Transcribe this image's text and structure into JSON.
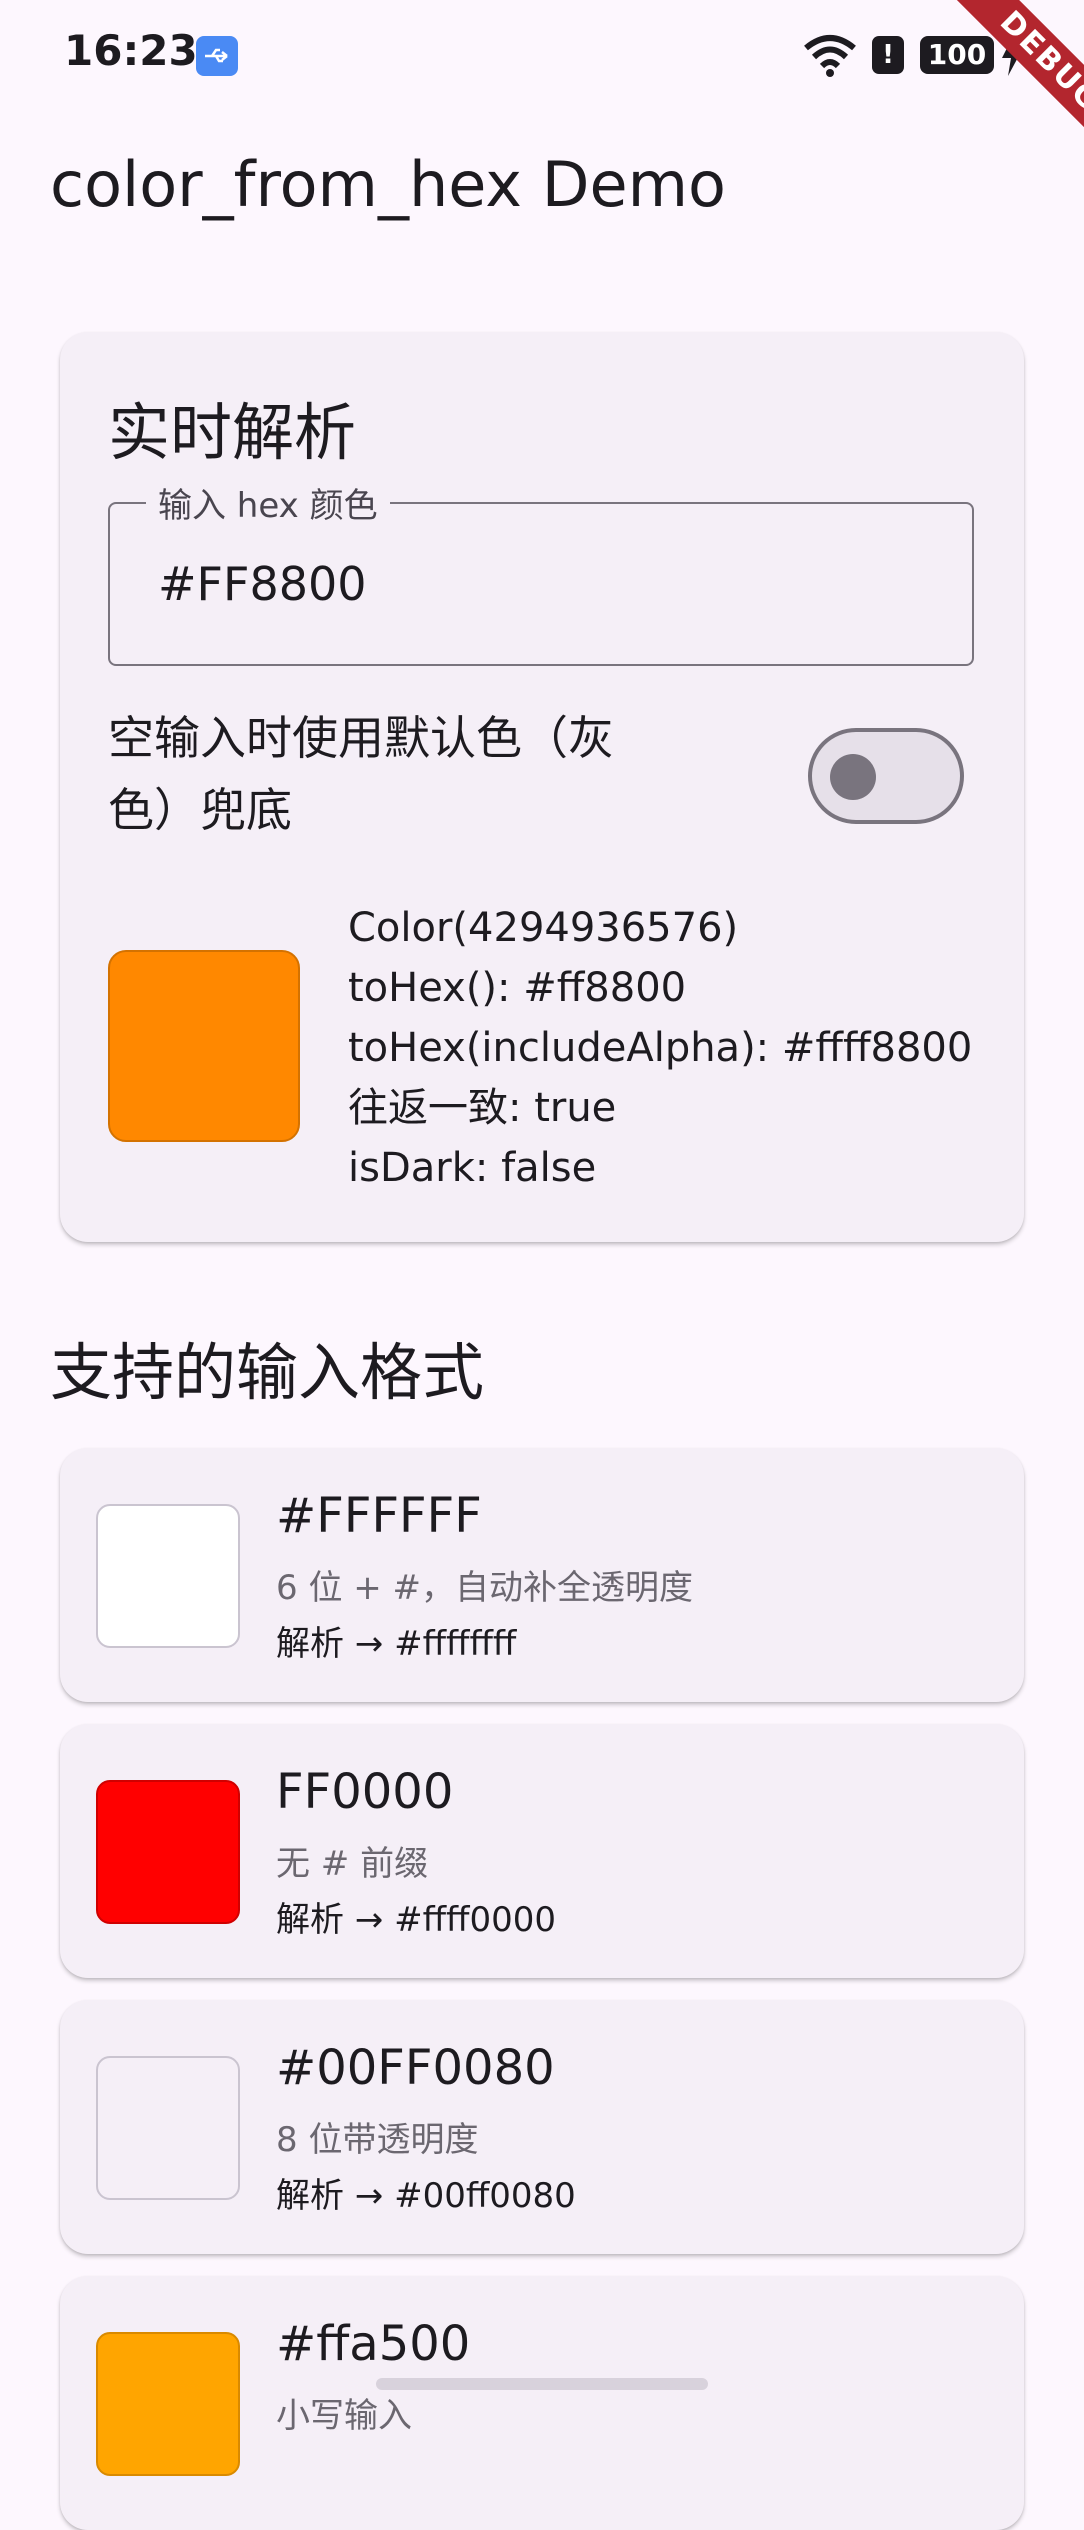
{
  "status_bar": {
    "time": "16:23",
    "battery": "100",
    "icons": [
      "usb-icon",
      "wifi-icon",
      "alert-icon",
      "battery-icon",
      "charging-icon"
    ]
  },
  "debug_banner": "DEBUG",
  "app_bar": {
    "title": "color_from_hex Demo"
  },
  "live_card": {
    "title": "实时解析",
    "input_label": "输入 hex 颜色",
    "input_value": "#FF8800",
    "switch_label": "空输入时使用默认色（灰色）兜底",
    "switch_on": false,
    "swatch_color": "#ff8800",
    "lines": [
      "Color(4294936576)",
      "toHex(): #ff8800",
      "toHex(includeAlpha): #ffff8800",
      "往返一致: true",
      "isDark: false"
    ]
  },
  "formats": {
    "title": "支持的输入格式",
    "items": [
      {
        "input": "#FFFFFF",
        "desc": "6 位 + #，自动补全透明度",
        "parsed": "解析 → #ffffffff",
        "color": "#ffffff"
      },
      {
        "input": "FF0000",
        "desc": "无 # 前缀",
        "parsed": "解析 → #ffff0000",
        "color": "#ff0000"
      },
      {
        "input": "#00FF0080",
        "desc": "8 位带透明度",
        "parsed": "解析 → #00ff0080",
        "color": "#f5eff7"
      },
      {
        "input": "#ffa500",
        "desc": "小写输入",
        "parsed": "",
        "color": "#ffa500"
      }
    ]
  }
}
